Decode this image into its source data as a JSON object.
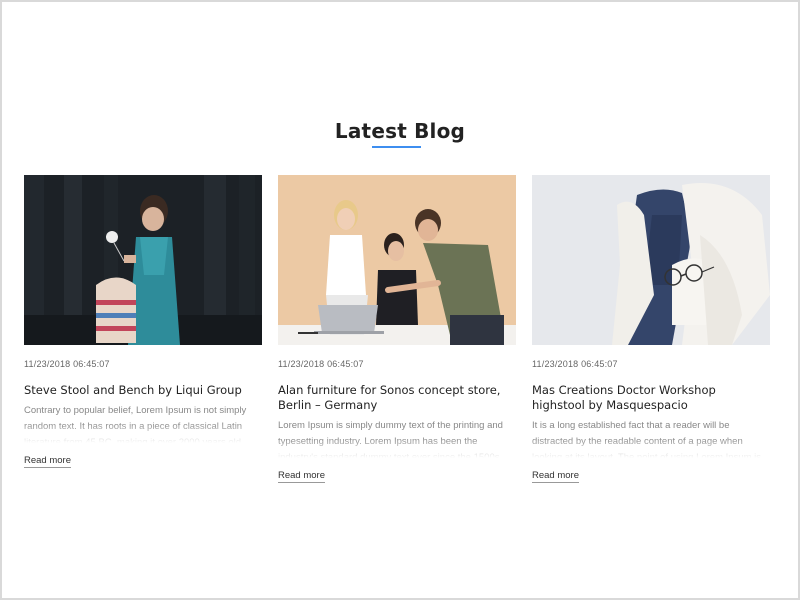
{
  "section": {
    "heading": "Latest Blog",
    "accent_color": "#3d8ef0"
  },
  "posts": [
    {
      "date": "11/23/2018 06:45:07",
      "title": "Steve Stool and Bench by Liqui Group",
      "excerpt": "Contrary to popular belief, Lorem Ipsum is not simply random text. It has roots in a piece of classical Latin literature from 45 BC, making it over 2000 years old.",
      "read_more": "Read more"
    },
    {
      "date": "11/23/2018 06:45:07",
      "title": "Alan furniture for Sonos concept store, Berlin – Germany",
      "excerpt": "Lorem Ipsum is simply dummy text of the printing and typesetting industry. Lorem Ipsum has been the industry's standard dummy text ever since the 1500s, when an",
      "read_more": "Read more"
    },
    {
      "date": "11/23/2018 06:45:07",
      "title": "Mas Creations Doctor Workshop highstool by Masquespacio",
      "excerpt": "It is a long established fact that a reader will be distracted by the readable content of a page when looking at its layout. The point of using Lorem Ipsum is",
      "read_more": "Read more"
    }
  ]
}
